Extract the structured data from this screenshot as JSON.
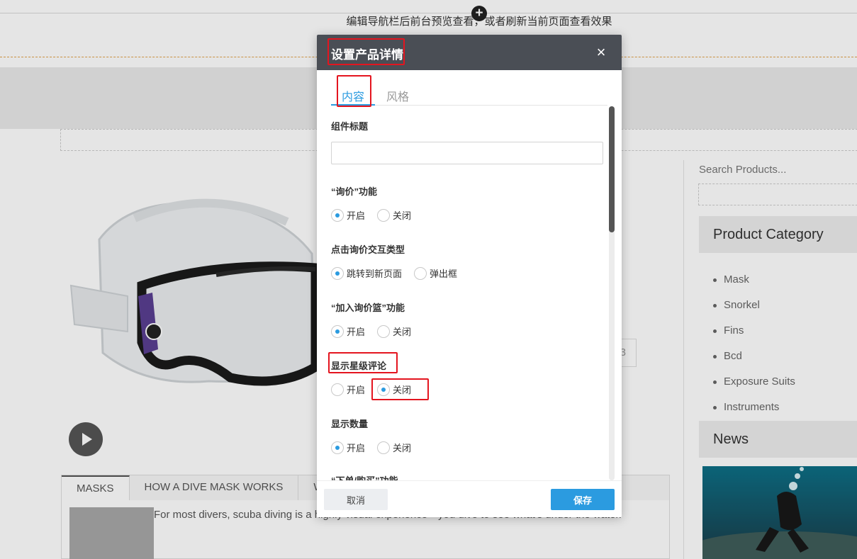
{
  "background": {
    "notice": "编辑导航栏后前台预览查看，或者刷新当前页面查看效果",
    "plus_icon": "+",
    "quantity_fragment": "3",
    "tabs": [
      {
        "label": "MASKS"
      },
      {
        "label": "HOW A DIVE MASK WORKS"
      },
      {
        "label": "W"
      }
    ],
    "content_text": "For most divers, scuba diving is a highly visual experience—you dive to see what's under the water.",
    "sidebar": {
      "search_placeholder": "Search Products...",
      "category_heading": "Product Category",
      "categories": [
        "Mask",
        "Snorkel",
        "Fins",
        "Bcd",
        "Exposure Suits",
        "Instruments"
      ],
      "news_heading": "News"
    }
  },
  "modal": {
    "title": "设置产品详情",
    "close_icon": "×",
    "tabs": [
      {
        "label": "内容",
        "active": true
      },
      {
        "label": "风格",
        "active": false
      }
    ],
    "fields": {
      "component_title": {
        "label": "组件标题",
        "value": ""
      },
      "inquiry": {
        "label": "“询价”功能",
        "options": [
          "开启",
          "关闭"
        ],
        "selected": "开启"
      },
      "inquiry_interaction": {
        "label": "点击询价交互类型",
        "options": [
          "跳转到新页面",
          "弹出框"
        ],
        "selected": "跳转到新页面"
      },
      "add_to_basket": {
        "label": "“加入询价篮”功能",
        "options": [
          "开启",
          "关闭"
        ],
        "selected": "开启"
      },
      "star_rating": {
        "label": "显示星级评论",
        "options": [
          "开启",
          "关闭"
        ],
        "selected": "关闭"
      },
      "quantity": {
        "label": "显示数量",
        "options": [
          "开启",
          "关闭"
        ],
        "selected": "开启"
      },
      "order": {
        "label": "“下单/购买”功能"
      }
    },
    "footer": {
      "cancel": "取消",
      "save": "保存"
    }
  },
  "colors": {
    "accent": "#2b9be0",
    "header": "#4a4e55",
    "highlight": "#e4151f"
  }
}
